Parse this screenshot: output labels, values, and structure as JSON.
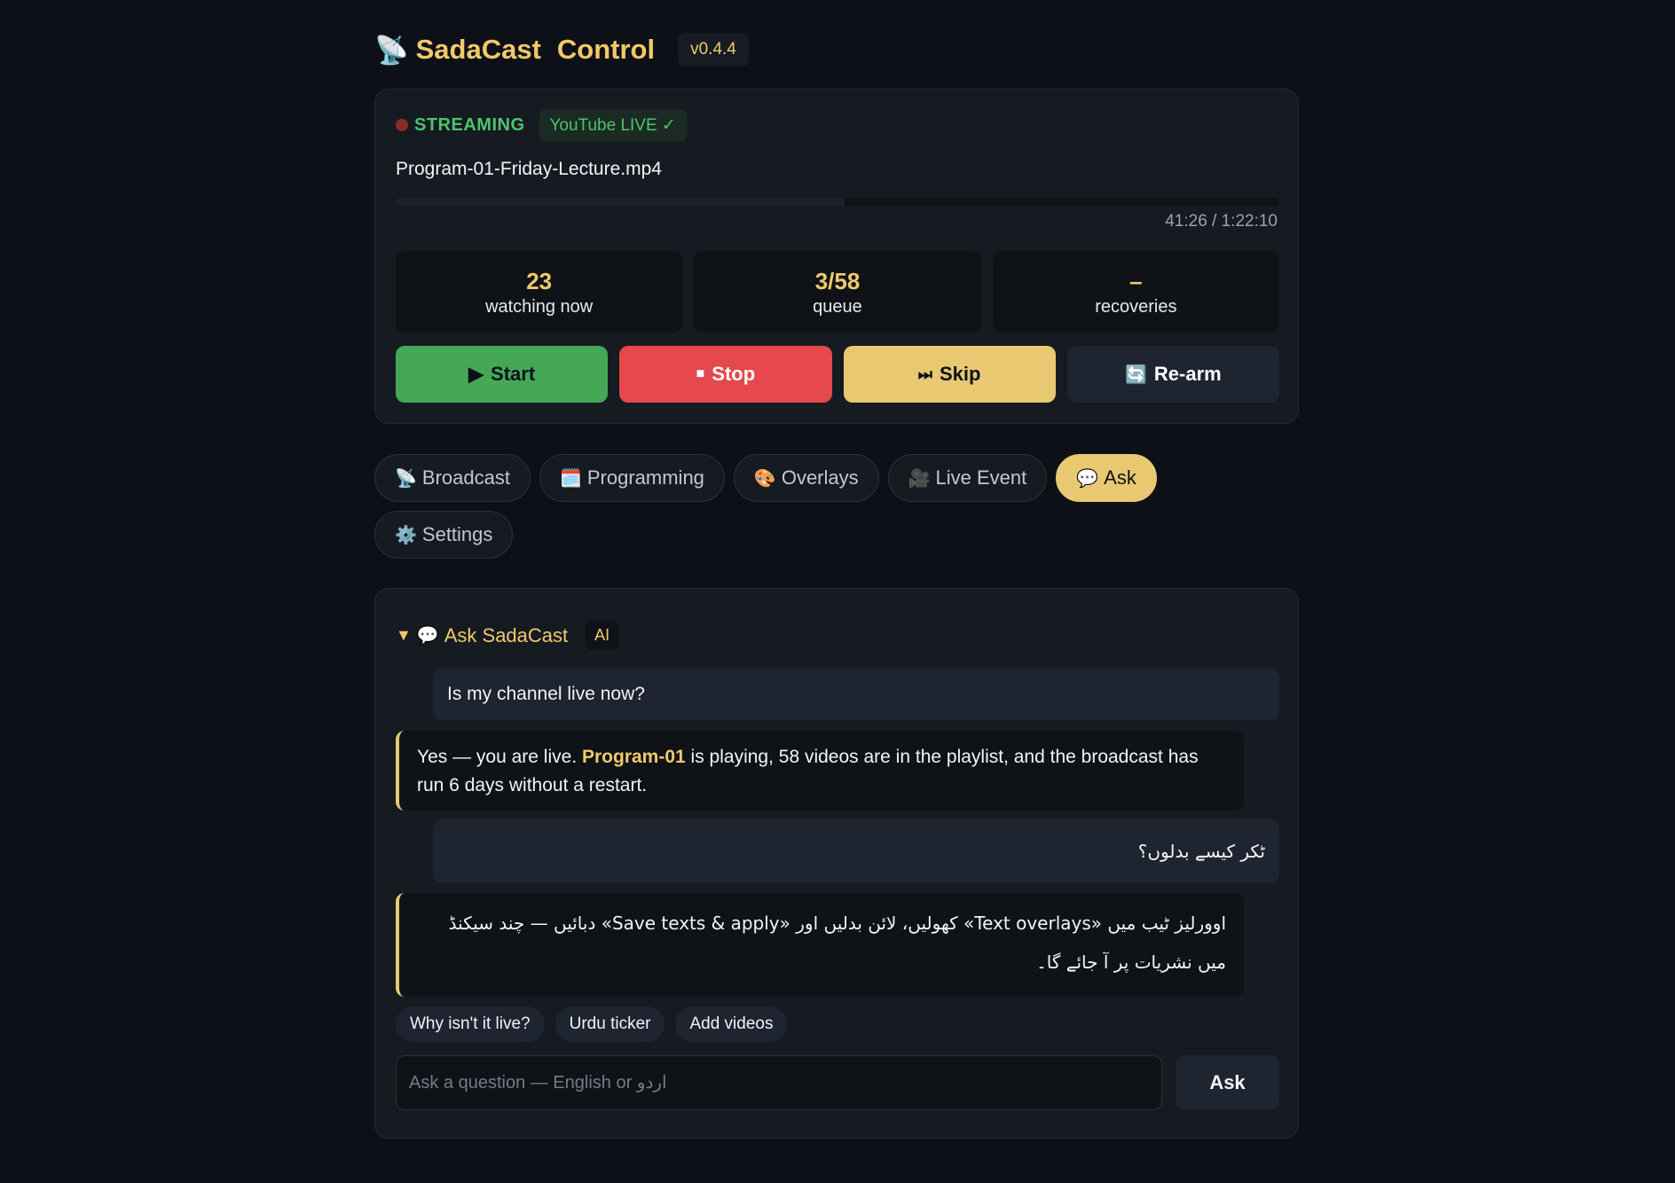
{
  "header": {
    "icon": "satellite-dish-icon",
    "title_word1": "SadaCast",
    "title_word2": "Control",
    "version": "v0.4.4"
  },
  "status": {
    "state": "STREAMING",
    "platform_badge": "YouTube LIVE ✓",
    "filename": "Program-01-Friday-Lecture.mp4",
    "progress_fraction": 0.5077,
    "time": "41:26 / 1:22:10",
    "colors": {
      "accent": "#f0c96a",
      "live": "#4cc46c",
      "stop": "#e5484d",
      "start": "#45a857"
    }
  },
  "stats": [
    {
      "value": "23",
      "label": "watching now"
    },
    {
      "value": "3/58",
      "label": "queue"
    },
    {
      "value": "–",
      "label": "recoveries"
    }
  ],
  "controls": {
    "start": {
      "icon": "▶",
      "label": "Start"
    },
    "stop": {
      "icon": "■",
      "label": "Stop"
    },
    "skip": {
      "icon": "⏭",
      "label": "Skip"
    },
    "rearm": {
      "icon": "🔄",
      "label": "Re-arm"
    }
  },
  "tabs": [
    {
      "icon": "📡",
      "icon_name": "satellite-dish-icon",
      "label": "Broadcast",
      "active": false
    },
    {
      "icon": "🗓️",
      "icon_name": "calendar-icon",
      "label": "Programming",
      "active": false
    },
    {
      "icon": "🎨",
      "icon_name": "palette-icon",
      "label": "Overlays",
      "active": false
    },
    {
      "icon": "🎥",
      "icon_name": "video-camera-icon",
      "label": "Live Event",
      "active": false
    },
    {
      "icon": "💬",
      "icon_name": "speech-bubble-icon",
      "label": "Ask",
      "active": true
    },
    {
      "icon": "⚙️",
      "icon_name": "gear-icon",
      "label": "Settings",
      "active": false
    }
  ],
  "ask": {
    "title": "Ask SadaCast",
    "badge": "AI",
    "messages": {
      "q1": "Is my channel live now?",
      "a1_pre": "Yes — you are live. ",
      "a1_highlight": "Program-01",
      "a1_post": " is playing, 58 videos are in the playlist, and the broadcast has run 6 days without a restart.",
      "q2": "ٹکر کیسے بدلوں؟",
      "a2": "اوورلیز ٹیب میں «Text overlays» کھولیں، لائن بدلیں اور «Save texts & apply» دبائیں — چند سیکنڈ میں نشریات پر آ جائے گا۔"
    },
    "chips": [
      "Why isn't it live?",
      "Urdu ticker",
      "Add videos"
    ],
    "input_placeholder": "Ask a question — English or اردو",
    "input_value": "",
    "submit_label": "Ask"
  }
}
